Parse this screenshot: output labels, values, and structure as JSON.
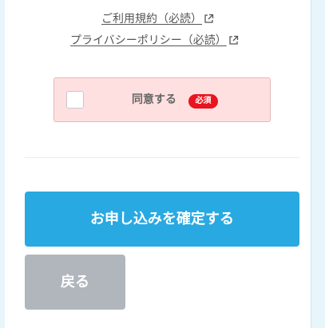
{
  "links": {
    "terms": "ご利用規約（必読）",
    "privacy": "プライバシーポリシー（必読）"
  },
  "agreement": {
    "label": "同意する",
    "required_badge": "必須",
    "checked": false
  },
  "actions": {
    "confirm_label": "お申し込みを確定する",
    "back_label": "戻る"
  },
  "colors": {
    "confirm_button": "#29a9e1",
    "back_button": "#b0b6bc",
    "required_badge": "#e8141f",
    "agree_box_bg": "#ffe0e0"
  },
  "icons": {
    "external_link": "external-link-icon"
  }
}
